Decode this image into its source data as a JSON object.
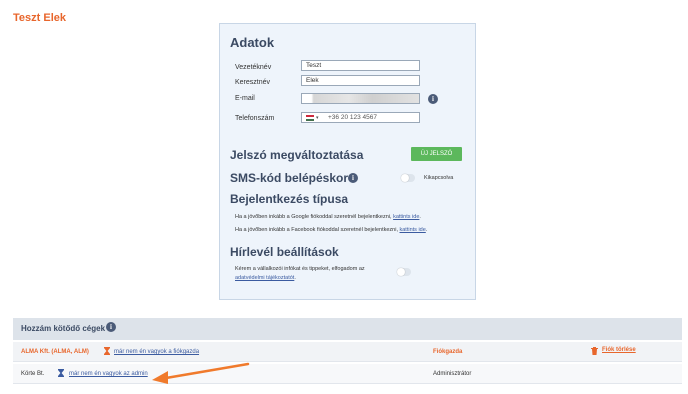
{
  "page": {
    "title": "Teszt Elek"
  },
  "data_panel": {
    "heading": "Adatok",
    "fields": {
      "last_name": {
        "label": "Vezetéknév",
        "value": "Teszt"
      },
      "first_name": {
        "label": "Keresztnév",
        "value": "Elek"
      },
      "email": {
        "label": "E-mail",
        "value": ""
      },
      "phone": {
        "label": "Telefonszám",
        "value": "+36 20 123 4567",
        "caret": "▾"
      }
    },
    "info_glyph": "i"
  },
  "password": {
    "heading": "Jelszó megváltoztatása",
    "button": "ÚJ JELSZÓ"
  },
  "sms": {
    "heading": "SMS-kód belépéskor",
    "toggle_label": "Kikapcsolva"
  },
  "login_type": {
    "heading": "Bejelentkezés típusa",
    "google_text": "Ha a jövőben inkább a Google fiókoddal szeretnél bejelentkezni,",
    "google_link": "kattints ide",
    "facebook_text": "Ha a jövőben inkább a Facebook fiókoddal szeretnél bejelentkezni,",
    "facebook_link": "kattints ide",
    "period": "."
  },
  "newsletter": {
    "heading": "Hírlevél beállítások",
    "text_line1": "Kérem a vállalkozói infókat és tippeket, elfogadom az",
    "link": "adatvédelmi tájékoztatót",
    "period": "."
  },
  "companies": {
    "heading": "Hozzám kötődő cégek",
    "rows": [
      {
        "name": "ALMA Kft. (ALMA, ALM)",
        "link": "már nem én vagyok a fiókgazda",
        "role": "Fiókgazda",
        "delete": "Fiók törlése"
      },
      {
        "name": "Körte Bt.",
        "link": "már nem én vagyok az admin",
        "role": "Adminisztrátor"
      }
    ]
  },
  "colors": {
    "accent": "#e8662c",
    "green": "#5cb85c",
    "link": "#3b5ba0",
    "panel": "#eef4fb"
  }
}
